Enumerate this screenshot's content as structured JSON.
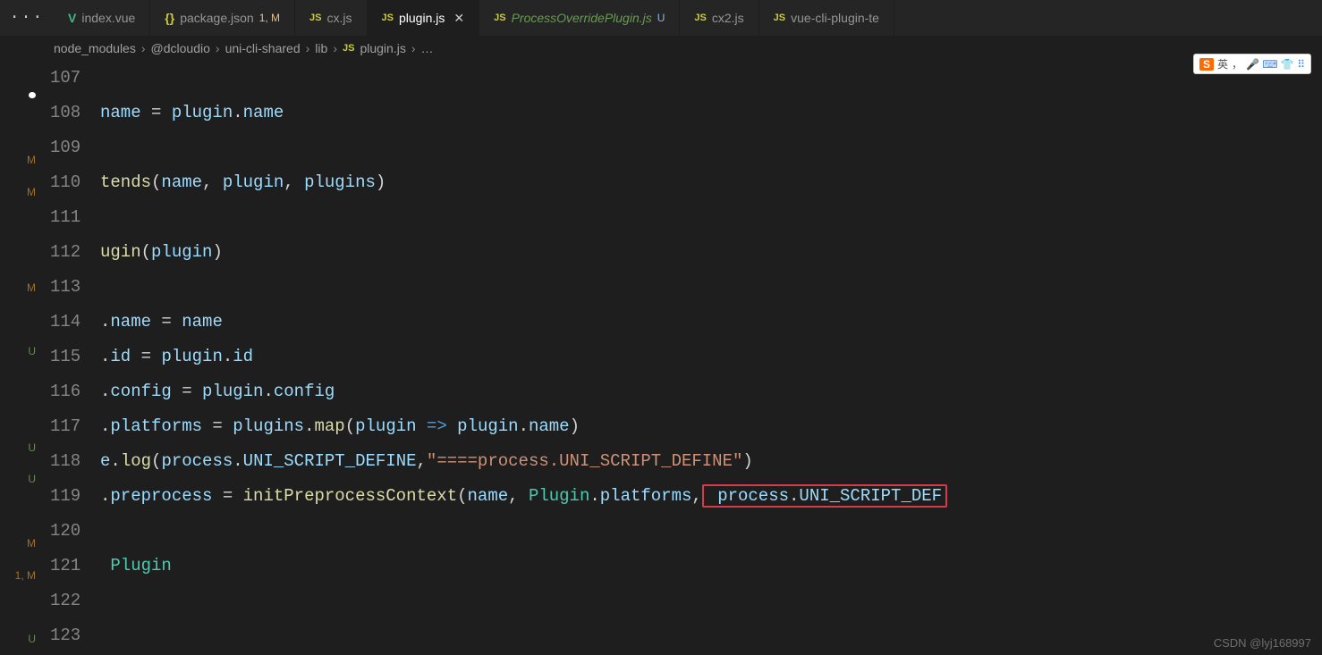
{
  "menu_dots": "···",
  "tabs": [
    {
      "icon": "V",
      "iconClass": "icon-vue",
      "filename": "index.vue",
      "suffix": ""
    },
    {
      "icon": "{}",
      "iconClass": "icon-json",
      "filename": "package.json",
      "suffix": "1, M",
      "suffixClass": "mod"
    },
    {
      "icon": "JS",
      "iconClass": "icon-js",
      "filename": "cx.js",
      "suffix": ""
    },
    {
      "icon": "JS",
      "iconClass": "icon-js",
      "filename": "plugin.js",
      "suffix": "",
      "active": true,
      "closeable": true
    },
    {
      "icon": "JS",
      "iconClass": "icon-js",
      "filename": "ProcessOverridePlugin.js",
      "suffix": "U",
      "suffixClass": "unsaved",
      "italic": true
    },
    {
      "icon": "JS",
      "iconClass": "icon-js",
      "filename": "cx2.js",
      "suffix": ""
    },
    {
      "icon": "JS",
      "iconClass": "icon-js",
      "filename": "vue-cli-plugin-te",
      "suffix": ""
    }
  ],
  "breadcrumb": {
    "parts": [
      "node_modules",
      "@dcloudio",
      "uni-cli-shared",
      "lib"
    ],
    "fileIcon": "JS",
    "file": "plugin.js",
    "trail": "…"
  },
  "gutter_indicators": [
    "",
    "M",
    "M",
    "",
    "",
    "M",
    "",
    "U",
    "",
    "",
    "U",
    "U",
    "",
    "M",
    "1, M",
    "",
    "U"
  ],
  "code_lines": [
    {
      "num": "107",
      "tokens": []
    },
    {
      "num": "108",
      "tokens": [
        {
          "t": "name",
          "c": "var"
        },
        {
          "t": " = ",
          "c": "pun"
        },
        {
          "t": "plugin",
          "c": "var"
        },
        {
          "t": ".",
          "c": "pun"
        },
        {
          "t": "name",
          "c": "prop"
        }
      ]
    },
    {
      "num": "109",
      "tokens": []
    },
    {
      "num": "110",
      "tokens": [
        {
          "t": "tends",
          "c": "fn"
        },
        {
          "t": "(",
          "c": "pun"
        },
        {
          "t": "name",
          "c": "var"
        },
        {
          "t": ", ",
          "c": "pun"
        },
        {
          "t": "plugin",
          "c": "var"
        },
        {
          "t": ", ",
          "c": "pun"
        },
        {
          "t": "plugins",
          "c": "var"
        },
        {
          "t": ")",
          "c": "pun"
        }
      ]
    },
    {
      "num": "111",
      "tokens": []
    },
    {
      "num": "112",
      "tokens": [
        {
          "t": "ugin",
          "c": "fn"
        },
        {
          "t": "(",
          "c": "pun"
        },
        {
          "t": "plugin",
          "c": "var"
        },
        {
          "t": ")",
          "c": "pun"
        }
      ]
    },
    {
      "num": "113",
      "tokens": []
    },
    {
      "num": "114",
      "tokens": [
        {
          "t": ".",
          "c": "pun"
        },
        {
          "t": "name",
          "c": "prop"
        },
        {
          "t": " = ",
          "c": "pun"
        },
        {
          "t": "name",
          "c": "var"
        }
      ]
    },
    {
      "num": "115",
      "tokens": [
        {
          "t": ".",
          "c": "pun"
        },
        {
          "t": "id",
          "c": "prop"
        },
        {
          "t": " = ",
          "c": "pun"
        },
        {
          "t": "plugin",
          "c": "var"
        },
        {
          "t": ".",
          "c": "pun"
        },
        {
          "t": "id",
          "c": "prop"
        }
      ]
    },
    {
      "num": "116",
      "tokens": [
        {
          "t": ".",
          "c": "pun"
        },
        {
          "t": "config",
          "c": "prop"
        },
        {
          "t": " = ",
          "c": "pun"
        },
        {
          "t": "plugin",
          "c": "var"
        },
        {
          "t": ".",
          "c": "pun"
        },
        {
          "t": "config",
          "c": "prop"
        }
      ]
    },
    {
      "num": "117",
      "tokens": [
        {
          "t": ".",
          "c": "pun"
        },
        {
          "t": "platforms",
          "c": "prop"
        },
        {
          "t": " = ",
          "c": "pun"
        },
        {
          "t": "plugins",
          "c": "var"
        },
        {
          "t": ".",
          "c": "pun"
        },
        {
          "t": "map",
          "c": "fn"
        },
        {
          "t": "(",
          "c": "pun"
        },
        {
          "t": "plugin",
          "c": "var"
        },
        {
          "t": " => ",
          "c": "kw"
        },
        {
          "t": "plugin",
          "c": "var"
        },
        {
          "t": ".",
          "c": "pun"
        },
        {
          "t": "name",
          "c": "prop"
        },
        {
          "t": ")",
          "c": "pun"
        }
      ]
    },
    {
      "num": "118",
      "tokens": [
        {
          "t": "e",
          "c": "var"
        },
        {
          "t": ".",
          "c": "pun"
        },
        {
          "t": "log",
          "c": "fn"
        },
        {
          "t": "(",
          "c": "pun"
        },
        {
          "t": "process",
          "c": "var"
        },
        {
          "t": ".",
          "c": "pun"
        },
        {
          "t": "UNI_SCRIPT_DEFINE",
          "c": "prop"
        },
        {
          "t": ",",
          "c": "pun"
        },
        {
          "t": "\"====process.UNI_SCRIPT_DEFINE\"",
          "c": "str"
        },
        {
          "t": ")",
          "c": "pun"
        }
      ]
    },
    {
      "num": "119",
      "tokens": [
        {
          "t": ".",
          "c": "pun"
        },
        {
          "t": "preprocess",
          "c": "prop"
        },
        {
          "t": " = ",
          "c": "pun"
        },
        {
          "t": "initPreprocessContext",
          "c": "fn"
        },
        {
          "t": "(",
          "c": "pun"
        },
        {
          "t": "name",
          "c": "var"
        },
        {
          "t": ", ",
          "c": "pun"
        },
        {
          "t": "Plugin",
          "c": "cls"
        },
        {
          "t": ".",
          "c": "pun"
        },
        {
          "t": "platforms",
          "c": "prop"
        },
        {
          "t": ",",
          "c": "pun"
        },
        {
          "t": " process",
          "c": "var",
          "boxStart": true
        },
        {
          "t": ".",
          "c": "pun",
          "boxMid": true
        },
        {
          "t": "UNI_SCRIPT_DEF",
          "c": "prop",
          "boxEnd": true
        }
      ]
    },
    {
      "num": "120",
      "tokens": []
    },
    {
      "num": "121",
      "tokens": [
        {
          "t": " ",
          "c": "pun"
        },
        {
          "t": "Plugin",
          "c": "cls"
        }
      ]
    },
    {
      "num": "122",
      "tokens": []
    },
    {
      "num": "123",
      "tokens": []
    }
  ],
  "ime": {
    "logo": "S",
    "lang": "英",
    "sep": "，",
    "icons": "🎤 ⌨ 👕 ⠿"
  },
  "watermark": "CSDN @lyj168997"
}
